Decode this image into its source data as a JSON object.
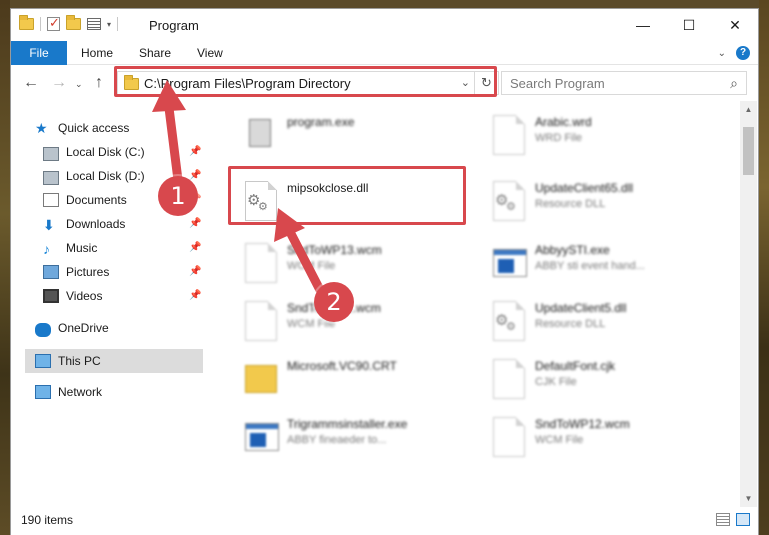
{
  "window": {
    "title": "Program",
    "minimize_glyph": "—",
    "maximize_glyph": "☐",
    "close_glyph": "✕"
  },
  "ribbon": {
    "tabs": [
      "File",
      "Home",
      "Share",
      "View"
    ],
    "help_glyph": "?"
  },
  "address": {
    "path": "C:\\Program Files\\Program Directory",
    "search_placeholder": "Search Program"
  },
  "sidebar": {
    "items": [
      {
        "label": "Quick access",
        "icon": "star-icon",
        "pinned": false
      },
      {
        "label": "Local Disk (C:)",
        "icon": "disk-icon",
        "pinned": true
      },
      {
        "label": "Local Disk (D:)",
        "icon": "disk-icon",
        "pinned": true
      },
      {
        "label": "Documents",
        "icon": "documents-icon",
        "pinned": true
      },
      {
        "label": "Downloads",
        "icon": "download-icon",
        "pinned": true
      },
      {
        "label": "Music",
        "icon": "music-icon",
        "pinned": true
      },
      {
        "label": "Pictures",
        "icon": "pictures-icon",
        "pinned": true
      },
      {
        "label": "Videos",
        "icon": "videos-icon",
        "pinned": true
      },
      {
        "label": "OneDrive",
        "icon": "onedrive-icon",
        "pinned": false
      },
      {
        "label": "This PC",
        "icon": "this-pc-icon",
        "pinned": false,
        "selected": true
      },
      {
        "label": "Network",
        "icon": "network-icon",
        "pinned": false
      }
    ]
  },
  "files": [
    {
      "name": "program.exe",
      "type": "",
      "icon": "program-icon",
      "blurred": true
    },
    {
      "name": "Arabic.wrd",
      "type": "WRD File",
      "icon": "document-icon",
      "blurred": true
    },
    {
      "name": "mipsokclose.dll",
      "type": "",
      "icon": "dll-gear-icon",
      "blurred": false
    },
    {
      "name": "UpdateClient65.dll",
      "type": "Resource DLL",
      "icon": "dll-gear-icon",
      "blurred": true
    },
    {
      "name": "SndToWP13.wcm",
      "type": "WCM File",
      "icon": "document-icon",
      "blurred": true
    },
    {
      "name": "AbbyySTI.exe",
      "type": "ABBY sti event hand...",
      "icon": "exe-icon",
      "blurred": true
    },
    {
      "name": "SndToWP11.wcm",
      "type": "WCM File",
      "icon": "document-icon",
      "blurred": true
    },
    {
      "name": "UpdateClient5.dll",
      "type": "Resource DLL",
      "icon": "dll-gear-icon",
      "blurred": true
    },
    {
      "name": "Microsoft.VC90.CRT",
      "type": "",
      "icon": "folder-icon",
      "blurred": true
    },
    {
      "name": "DefaultFont.cjk",
      "type": "CJK File",
      "icon": "document-icon",
      "blurred": true
    },
    {
      "name": "Trigrammsinstaller.exe",
      "type": "ABBY fineaeder to...",
      "icon": "exe-icon",
      "blurred": true
    },
    {
      "name": "SndToWP12.wcm",
      "type": "WCM File",
      "icon": "document-icon",
      "blurred": true
    }
  ],
  "status": {
    "item_count": "190 items"
  },
  "annotations": {
    "step1": "1",
    "step2": "2",
    "accent_color": "#d8484d"
  },
  "colors": {
    "file_tab": "#1979ca",
    "selection": "#dcdcdc"
  }
}
